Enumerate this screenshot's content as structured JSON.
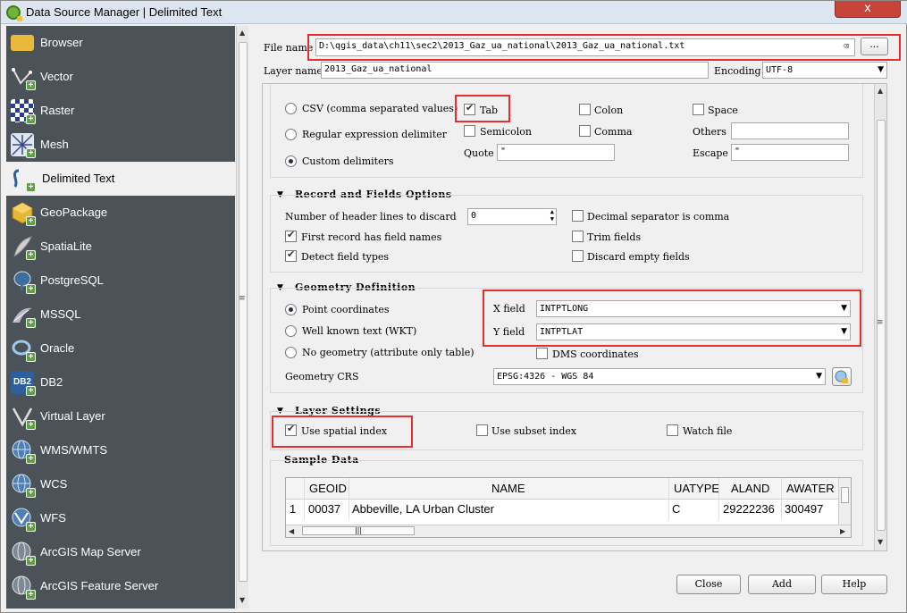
{
  "window": {
    "title": "Data Source Manager | Delimited Text",
    "close_glyph": "x"
  },
  "sidebar": {
    "items": [
      {
        "label": "Browser"
      },
      {
        "label": "Vector"
      },
      {
        "label": "Raster"
      },
      {
        "label": "Mesh"
      },
      {
        "label": "Delimited Text"
      },
      {
        "label": "GeoPackage"
      },
      {
        "label": "SpatiaLite"
      },
      {
        "label": "PostgreSQL"
      },
      {
        "label": "MSSQL"
      },
      {
        "label": "Oracle"
      },
      {
        "label": "DB2"
      },
      {
        "label": "Virtual Layer"
      },
      {
        "label": "WMS/WMTS"
      },
      {
        "label": "WCS"
      },
      {
        "label": "WFS"
      },
      {
        "label": "ArcGIS Map Server"
      },
      {
        "label": "ArcGIS Feature Server"
      }
    ],
    "db2_icon_text": "DB2"
  },
  "file": {
    "label": "File name",
    "value": "D:\\qgis_data\\ch11\\sec2\\2013_Gaz_ua_national\\2013_Gaz_ua_national.txt",
    "browse_label": "..."
  },
  "layer": {
    "label": "Layer name",
    "value": "2013_Gaz_ua_national"
  },
  "encoding": {
    "label": "Encoding",
    "value": "UTF-8"
  },
  "file_format": {
    "csv": "CSV (comma separated values)",
    "regex": "Regular expression delimiter",
    "custom": "Custom delimiters",
    "tab": "Tab",
    "colon": "Colon",
    "space": "Space",
    "semicolon": "Semicolon",
    "comma": "Comma",
    "others": "Others",
    "quote_label": "Quote",
    "quote_value": "\"",
    "escape_label": "Escape",
    "escape_value": "\""
  },
  "record_options": {
    "title": "Record and Fields Options",
    "header_lines_label": "Number of header lines to discard",
    "header_lines_value": "0",
    "decimal_comma": "Decimal separator is comma",
    "first_record": "First record has field names",
    "trim": "Trim fields",
    "detect_types": "Detect field types",
    "discard_empty": "Discard empty fields"
  },
  "geometry": {
    "title": "Geometry Definition",
    "point": "Point coordinates",
    "wkt": "Well known text (WKT)",
    "none": "No geometry (attribute only table)",
    "x_label": "X field",
    "x_value": "INTPTLONG",
    "y_label": "Y field",
    "y_value": "INTPTLAT",
    "dms": "DMS coordinates",
    "crs_label": "Geometry CRS",
    "crs_value": "EPSG:4326 - WGS 84"
  },
  "layer_settings": {
    "title": "Layer Settings",
    "spatial_index": "Use spatial index",
    "subset_index": "Use subset index",
    "watch_file": "Watch file"
  },
  "sample": {
    "title": "Sample Data",
    "columns": [
      "GEOID",
      "NAME",
      "UATYPE",
      "ALAND",
      "AWATER"
    ],
    "rows": [
      {
        "num": "1",
        "cells": [
          "00037",
          "Abbeville, LA Urban Cluster",
          "C",
          "29222236",
          "300497"
        ]
      }
    ]
  },
  "buttons": {
    "close": "Close",
    "add": "Add",
    "help": "Help"
  }
}
